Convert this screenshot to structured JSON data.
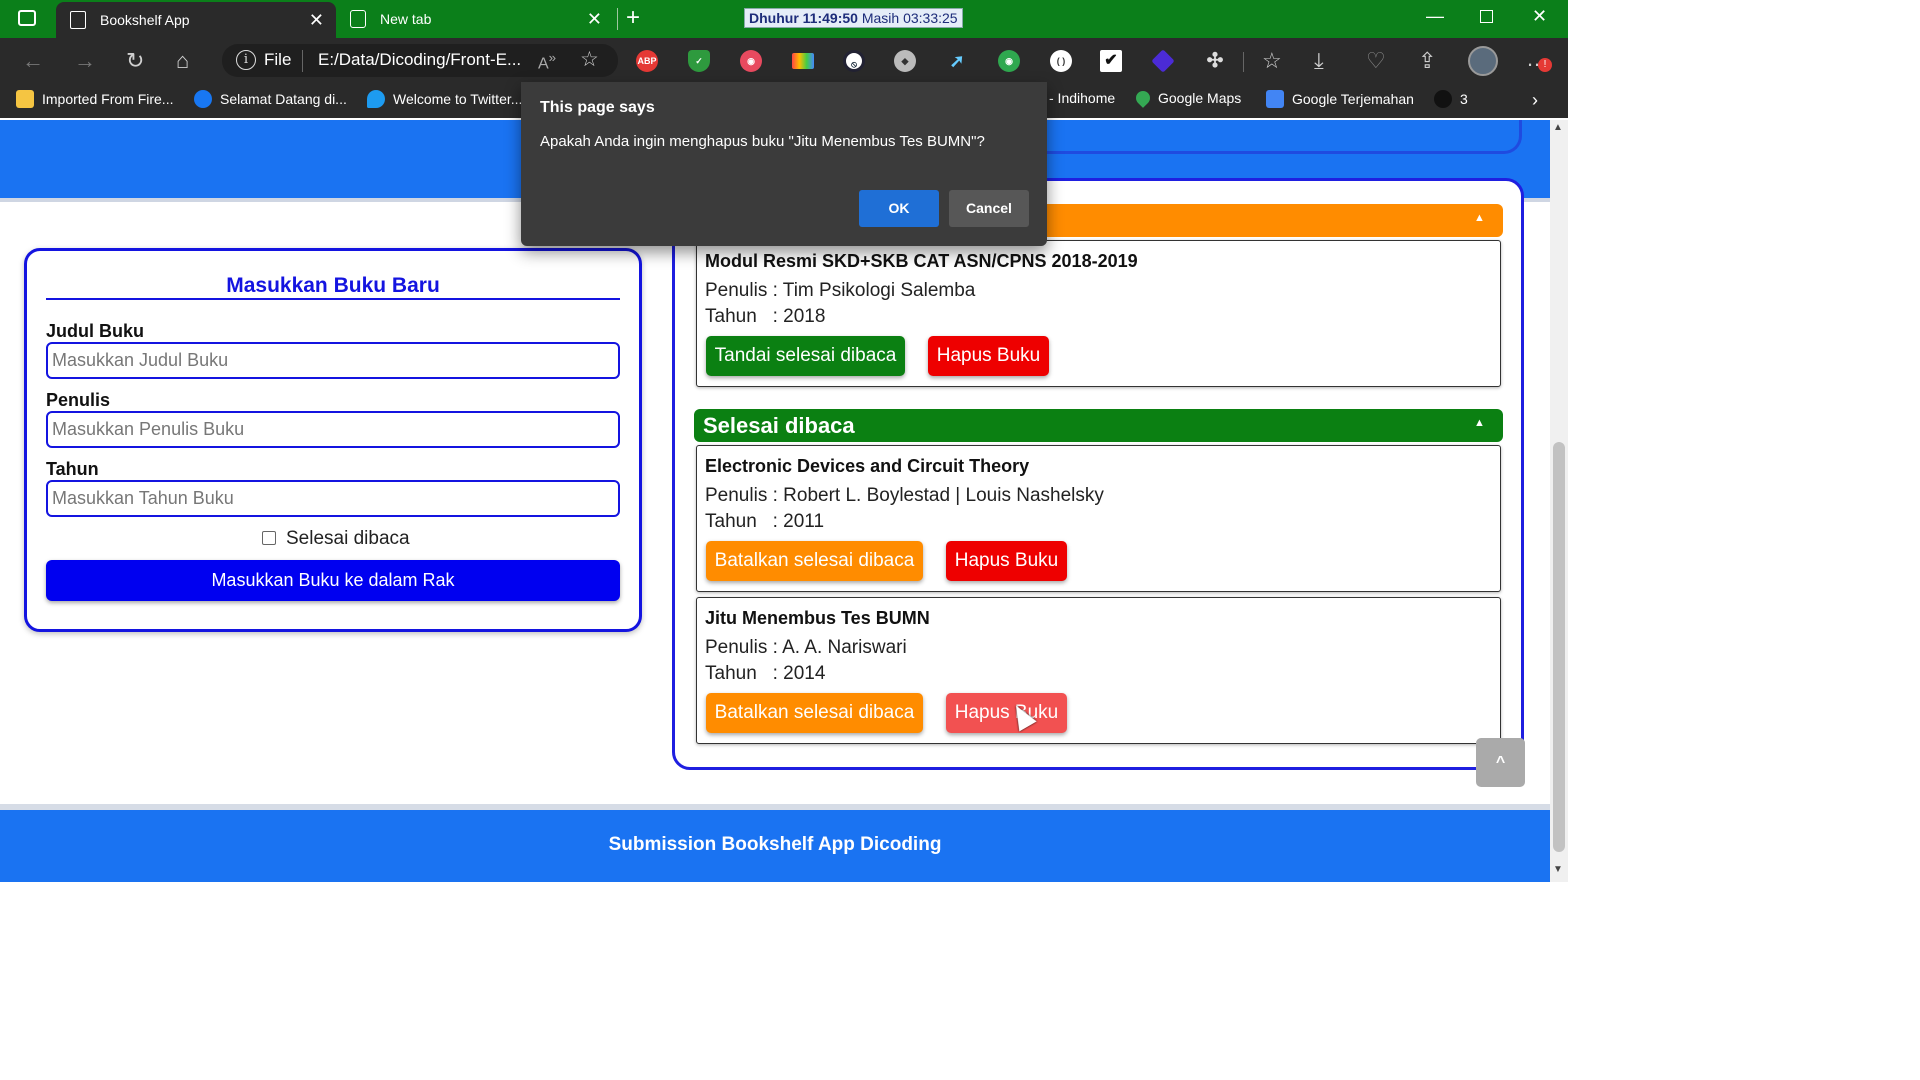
{
  "browser": {
    "tabs": [
      {
        "label": "Bookshelf App",
        "active": true
      },
      {
        "label": "New tab",
        "active": false
      }
    ],
    "clock": {
      "prayer": "Dhuhur",
      "time": "11:49:50",
      "remaining_label": "Masih",
      "remaining": "03:33:25"
    },
    "address": {
      "scheme": "File",
      "url": "E:/Data/Dicoding/Front-E..."
    },
    "extensions": [
      "ABP",
      "shield-icon",
      "ublock-icon",
      "palette-icon",
      "blocker-icon",
      "vpn-icon",
      "cursor-icon",
      "eye-icon",
      "sync-icon",
      "checkbox-icon",
      "cube-icon",
      "puzzle-icon"
    ],
    "bookmarks": [
      {
        "label": "Imported From Fire...",
        "icon": "folder-icon",
        "color": "#f5c542"
      },
      {
        "label": "Selamat Datang di...",
        "icon": "facebook-icon",
        "color": "#1877f2"
      },
      {
        "label": "Welcome to Twitter...",
        "icon": "twitter-icon",
        "color": "#1d9bf0"
      },
      {
        "label": "- Indihome",
        "icon": "",
        "color": ""
      },
      {
        "label": "Google Maps",
        "icon": "maps-icon",
        "color": "#34a853"
      },
      {
        "label": "Google Terjemahan",
        "icon": "translate-icon",
        "color": "#4285f4"
      },
      {
        "label": "3",
        "icon": "spy-icon",
        "color": "#222"
      }
    ]
  },
  "form": {
    "title": "Masukkan Buku Baru",
    "title_label": "Judul Buku",
    "title_placeholder": "Masukkan Judul Buku",
    "author_label": "Penulis",
    "author_placeholder": "Masukkan Penulis Buku",
    "year_label": "Tahun",
    "year_placeholder": "Masukkan Tahun Buku",
    "checkbox_label": "Selesai dibaca",
    "submit_label": "Masukkan Buku ke dalam Rak"
  },
  "shelves": {
    "read_heading": "Selesai dibaca",
    "unread_books": [
      {
        "title": "Modul Resmi SKD+SKB CAT ASN/CPNS 2018-2019",
        "author_line": "Penulis : Tim Psikologi Salemba",
        "year_line": "Tahun   : 2018",
        "toggle_label": "Tandai selesai dibaca",
        "delete_label": "Hapus Buku"
      }
    ],
    "read_books": [
      {
        "title": "Electronic Devices and Circuit Theory",
        "author_line": "Penulis : Robert L. Boylestad | Louis Nashelsky",
        "year_line": "Tahun   : 2011",
        "toggle_label": "Batalkan selesai dibaca",
        "delete_label": "Hapus Buku"
      },
      {
        "title": "Jitu Menembus Tes BUMN",
        "author_line": "Penulis : A. A. Nariswari",
        "year_line": "Tahun   : 2014",
        "toggle_label": "Batalkan selesai dibaca",
        "delete_label": "Hapus Buku"
      }
    ]
  },
  "to_top_label": "^",
  "footer": {
    "text": "Submission Bookshelf App Dicoding"
  },
  "dialog": {
    "title": "This page says",
    "message": "Apakah Anda ingin menghapus buku \"Jitu Menembus Tes BUMN\"?",
    "ok_label": "OK",
    "cancel_label": "Cancel"
  },
  "colors": {
    "header_blue": "#1a73f2",
    "form_blue": "#1414e0",
    "unread_orange": "#ff8c00",
    "read_green": "#0b8012",
    "delete_red": "#ee0000",
    "chrome_green": "#0b7f1a"
  }
}
